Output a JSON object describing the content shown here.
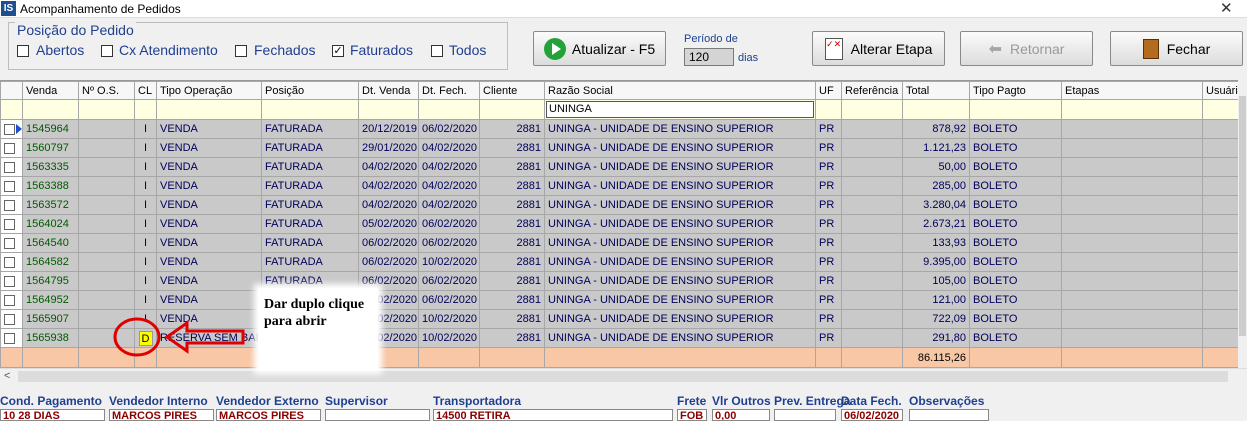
{
  "window": {
    "title": "Acompanhamento de Pedidos",
    "app_icon": "IS",
    "close_glyph": "✕"
  },
  "filter": {
    "group_title": "Posição do Pedido",
    "checkboxes": [
      {
        "label": "Abertos",
        "checked": false
      },
      {
        "label": "Cx Atendimento",
        "checked": false
      },
      {
        "label": "Fechados",
        "checked": false
      },
      {
        "label": "Faturados",
        "checked": true
      },
      {
        "label": "Todos",
        "checked": false
      }
    ],
    "check_mark": "✓"
  },
  "toolbar": {
    "atualizar": "Atualizar - F5",
    "periodo_label": "Período de",
    "periodo_value": "120",
    "dias_label": "dias",
    "alterar_etapa": "Alterar Etapa",
    "retornar": "Retornar",
    "fechar": "Fechar"
  },
  "grid": {
    "columns": [
      "Venda",
      "Nº O.S.",
      "CL",
      "Tipo Operação",
      "Posição",
      "Dt. Venda",
      "Dt. Fech.",
      "Cliente",
      "Razão Social",
      "UF",
      "Referência",
      "Total",
      "Tipo Pagto",
      "Etapas",
      "Usuário"
    ],
    "razao_filter": "UNINGA",
    "rows": [
      {
        "venda": "1545964",
        "os": "",
        "cl": "I",
        "tipo": "VENDA",
        "posicao": "FATURADA",
        "dt_venda": "20/12/2019",
        "dt_fech": "06/02/2020",
        "cliente": "2881",
        "razao": "UNINGA - UNIDADE DE ENSINO SUPERIOR",
        "uf": "PR",
        "ref": "",
        "total": "878,92",
        "pagto": "BOLETO"
      },
      {
        "venda": "1560797",
        "os": "",
        "cl": "I",
        "tipo": "VENDA",
        "posicao": "FATURADA",
        "dt_venda": "29/01/2020",
        "dt_fech": "04/02/2020",
        "cliente": "2881",
        "razao": "UNINGA - UNIDADE DE ENSINO SUPERIOR",
        "uf": "PR",
        "ref": "",
        "total": "1.121,23",
        "pagto": "BOLETO"
      },
      {
        "venda": "1563335",
        "os": "",
        "cl": "I",
        "tipo": "VENDA",
        "posicao": "FATURADA",
        "dt_venda": "04/02/2020",
        "dt_fech": "04/02/2020",
        "cliente": "2881",
        "razao": "UNINGA - UNIDADE DE ENSINO SUPERIOR",
        "uf": "PR",
        "ref": "",
        "total": "50,00",
        "pagto": "BOLETO"
      },
      {
        "venda": "1563388",
        "os": "",
        "cl": "I",
        "tipo": "VENDA",
        "posicao": "FATURADA",
        "dt_venda": "04/02/2020",
        "dt_fech": "04/02/2020",
        "cliente": "2881",
        "razao": "UNINGA - UNIDADE DE ENSINO SUPERIOR",
        "uf": "PR",
        "ref": "",
        "total": "285,00",
        "pagto": "BOLETO"
      },
      {
        "venda": "1563572",
        "os": "",
        "cl": "I",
        "tipo": "VENDA",
        "posicao": "FATURADA",
        "dt_venda": "04/02/2020",
        "dt_fech": "04/02/2020",
        "cliente": "2881",
        "razao": "UNINGA - UNIDADE DE ENSINO SUPERIOR",
        "uf": "PR",
        "ref": "",
        "total": "3.280,04",
        "pagto": "BOLETO"
      },
      {
        "venda": "1564024",
        "os": "",
        "cl": "I",
        "tipo": "VENDA",
        "posicao": "FATURADA",
        "dt_venda": "05/02/2020",
        "dt_fech": "06/02/2020",
        "cliente": "2881",
        "razao": "UNINGA - UNIDADE DE ENSINO SUPERIOR",
        "uf": "PR",
        "ref": "",
        "total": "2.673,21",
        "pagto": "BOLETO"
      },
      {
        "venda": "1564540",
        "os": "",
        "cl": "I",
        "tipo": "VENDA",
        "posicao": "FATURADA",
        "dt_venda": "06/02/2020",
        "dt_fech": "06/02/2020",
        "cliente": "2881",
        "razao": "UNINGA - UNIDADE DE ENSINO SUPERIOR",
        "uf": "PR",
        "ref": "",
        "total": "133,93",
        "pagto": "BOLETO"
      },
      {
        "venda": "1564582",
        "os": "",
        "cl": "I",
        "tipo": "VENDA",
        "posicao": "FATURADA",
        "dt_venda": "06/02/2020",
        "dt_fech": "10/02/2020",
        "cliente": "2881",
        "razao": "UNINGA - UNIDADE DE ENSINO SUPERIOR",
        "uf": "PR",
        "ref": "",
        "total": "9.395,00",
        "pagto": "BOLETO"
      },
      {
        "venda": "1564795",
        "os": "",
        "cl": "I",
        "tipo": "VENDA",
        "posicao": "FATURADA",
        "dt_venda": "06/02/2020",
        "dt_fech": "06/02/2020",
        "cliente": "2881",
        "razao": "UNINGA - UNIDADE DE ENSINO SUPERIOR",
        "uf": "PR",
        "ref": "",
        "total": "105,00",
        "pagto": "BOLETO"
      },
      {
        "venda": "1564952",
        "os": "",
        "cl": "I",
        "tipo": "VENDA",
        "posicao": "FATURADA",
        "dt_venda": "06/02/2020",
        "dt_fech": "06/02/2020",
        "cliente": "2881",
        "razao": "UNINGA - UNIDADE DE ENSINO SUPERIOR",
        "uf": "PR",
        "ref": "",
        "total": "121,00",
        "pagto": "BOLETO"
      },
      {
        "venda": "1565907",
        "os": "",
        "cl": "I",
        "tipo": "VENDA",
        "posicao": "FATURADA",
        "dt_venda": "07/02/2020",
        "dt_fech": "10/02/2020",
        "cliente": "2881",
        "razao": "UNINGA - UNIDADE DE ENSINO SUPERIOR",
        "uf": "PR",
        "ref": "",
        "total": "722,09",
        "pagto": "BOLETO"
      },
      {
        "venda": "1565938",
        "os": "",
        "cl": "D",
        "tipo": "RESERVA SEM BAIXA",
        "posicao": "FATURADA",
        "dt_venda": "10/02/2020",
        "dt_fech": "10/02/2020",
        "cliente": "2881",
        "razao": "UNINGA - UNIDADE DE ENSINO SUPERIOR",
        "uf": "PR",
        "ref": "",
        "total": "291,80",
        "pagto": "BOLETO"
      }
    ],
    "total_sum": "86.115,26"
  },
  "annotation": {
    "text": "Dar duplo clique para abrir"
  },
  "footer": {
    "labels": [
      "Cond. Pagamento",
      "Vendedor Interno",
      "Vendedor Externo",
      "Supervisor",
      "Transportadora",
      "Frete",
      "Vlr Outros",
      "Prev. Entrega",
      "Data Fech.",
      "Observações"
    ],
    "values": [
      "10 28 DIAS",
      "MARCOS PIRES SZI",
      "MARCOS PIRES SZI",
      "",
      "14500 RETIRA",
      "FOB",
      "0,00",
      "",
      "06/02/2020",
      ""
    ]
  },
  "colors": {
    "selected_grid": "#c9c9c9",
    "total_row": "#f7c7a6",
    "filter_row": "#ffffe1",
    "annotation_red": "#e00000"
  }
}
